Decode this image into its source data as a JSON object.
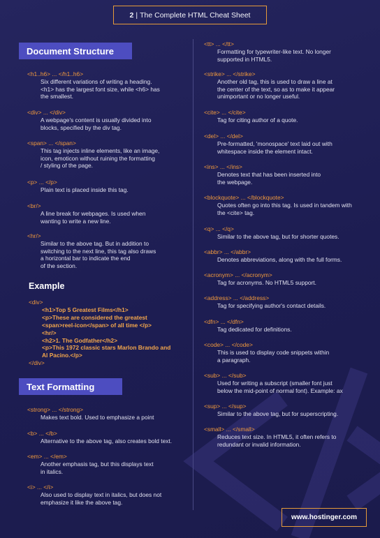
{
  "header": {
    "page_number": "2",
    "separator": "|",
    "title": "The Complete HTML Cheat Sheet"
  },
  "left": {
    "document_structure": {
      "heading": "Document Structure",
      "items": [
        {
          "tag": "<h1..h6> ... </h1..h6>",
          "desc": [
            "Six different variations of writing a heading.",
            "<h1> has the largest font size, while <h6> has",
            "the smallest."
          ]
        },
        {
          "tag": "<div> ... </div>",
          "desc": [
            "A webpage's content is usually divided into",
            "blocks, specified by the div tag."
          ]
        },
        {
          "tag": "<span> ... </span>",
          "desc": [
            "This tag injects inline elements, like an image,",
            "icon, emoticon without ruining the formatting",
            "/ styling of the page."
          ]
        },
        {
          "tag": "<p> ... </p>",
          "desc": [
            "Plain text is placed inside this tag."
          ]
        },
        {
          "tag": "<br/>",
          "desc": [
            "A line break for webpages. Is used when",
            "wanting to write a new line."
          ]
        },
        {
          "tag": "<hr/>",
          "desc": [
            "Similar to the above tag. But in addition to",
            "switching to the next line, this tag also draws",
            "a horizontal bar to indicate the end",
            "of the section."
          ]
        }
      ]
    },
    "example": {
      "title": "Example",
      "open": "<div>",
      "lines": [
        "<h1>Top 5 Greatest Films</h1>",
        "<p>These are considered the greatest",
        "<span>reel-icon</span> of all time </p>",
        "<hr/>",
        "<h2>1. The Godfather</h2>",
        "<p>This 1972 classic stars Marlon Brando and",
        "Al Pacino.</p>"
      ],
      "close": "</div>"
    },
    "text_formatting": {
      "heading": "Text Formatting",
      "items": [
        {
          "tag": "<strong> ... </strong>",
          "desc": [
            "Makes text bold. Used to emphasize a point"
          ]
        },
        {
          "tag": "<b> ... </b>",
          "desc": [
            "Alternative to the above tag, also creates bold text."
          ]
        },
        {
          "tag": "<em> ... </em>",
          "desc": [
            "Another emphasis tag, but this displays text",
            "in italics."
          ]
        },
        {
          "tag": "<i> ... </i>",
          "desc": [
            "Also used to display text in italics, but does not",
            "emphasize it like the above tag."
          ]
        }
      ]
    }
  },
  "right": {
    "items": [
      {
        "tag": "<tt> ... </tt>",
        "desc": [
          "Formatting for typewriter-like text. No longer",
          "supported in HTML5."
        ]
      },
      {
        "tag": "<strike> ... </strike>",
        "desc": [
          "Another old tag, this is used to draw a line at",
          "the center of the text, so as to make it appear",
          "unimportant or no longer useful."
        ]
      },
      {
        "tag": "<cite> ... </cite>",
        "desc": [
          "Tag for citing author of a quote."
        ]
      },
      {
        "tag": "<del> ... </del>",
        "desc": [
          "Pre-formatted, 'monospace' text laid out with",
          "whitespace inside the element intact."
        ]
      },
      {
        "tag": "<ins> ... </ins>",
        "desc": [
          "Denotes text that has been inserted into",
          "the webpage."
        ]
      },
      {
        "tag": "<blockquote> ... </blockquote>",
        "desc": [
          "Quotes often go into this tag. Is used in tandem with",
          "the <cite> tag."
        ]
      },
      {
        "tag": "<q> ... </q>",
        "desc": [
          "Similar to the above tag, but for shorter quotes."
        ]
      },
      {
        "tag": "<abbr> ... </abbr>",
        "desc": [
          "Denotes abbreviations, along with the full forms."
        ]
      },
      {
        "tag": "<acronym> ... </acronym>",
        "desc": [
          "Tag for acronyms. No HTML5 support."
        ]
      },
      {
        "tag": "<address> ... </address>",
        "desc": [
          "Tag for specifying author's contact details."
        ]
      },
      {
        "tag": "<dfn> ... </dfn>",
        "desc": [
          "Tag dedicated for definitions."
        ]
      },
      {
        "tag": "<code> ... </code>",
        "desc": [
          "This is used to display code snippets within",
          "a paragraph."
        ]
      },
      {
        "tag": "<sub> ... </sub>",
        "desc": [
          "Used for writing a subscript (smaller font just",
          "below the mid-point of normal font). Example: ax"
        ]
      },
      {
        "tag": "<sup> ... </sup>",
        "desc": [
          "Similar to the above tag, but for superscripting."
        ]
      },
      {
        "tag": "<small> ... </small>",
        "desc": [
          "Reduces text size. In HTML5, it often refers to",
          "redundant or invalid information."
        ]
      }
    ]
  },
  "footer": {
    "url": "www.hostinger.com"
  },
  "colors": {
    "background": "#1f1f55",
    "accent_orange": "#f29a3c",
    "heading_bg": "#4d4dc0"
  }
}
